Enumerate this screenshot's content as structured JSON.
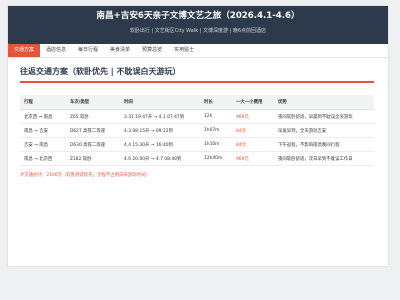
{
  "header": {
    "title": "南昌+吉安6天亲子文博文艺之旅（2026.4.1-4.6）",
    "subtitle": "软卧出行 | 文艺街区City Walk | 文博深度游 | 晚6点前回酒店"
  },
  "tabs": [
    {
      "label": "交通方案",
      "active": true
    },
    {
      "label": "酒店信息",
      "active": false
    },
    {
      "label": "每日行程",
      "active": false
    },
    {
      "label": "美食清单",
      "active": false
    },
    {
      "label": "预算总览",
      "active": false
    },
    {
      "label": "实用贴士",
      "active": false
    }
  ],
  "section": {
    "title": "往返交通方案（软卧优先 | 不耽误白天游玩）"
  },
  "table": {
    "headers": [
      "行程",
      "车次/类型",
      "时间",
      "时长",
      "一大一小费用",
      "优势"
    ],
    "rows": [
      [
        "北京西 → 南昌",
        "Z65 软卧",
        "3.31 19:47开 → 4.1 07:47到",
        "12h",
        "969元",
        "夜间软卧舒适，早晨到不耽误全天游玩"
      ],
      [
        "南昌 → 吉安",
        "D627 高铁二等座",
        "4.3 08:15开 → 09:22到",
        "1h07m",
        "84元",
        "早发早到，全天游玩吉安"
      ],
      [
        "吉安 → 南昌",
        "D630 高铁二等座",
        "4.4 15:30开 → 16:40到",
        "1h10m",
        "84元",
        "下午返程，不影响南昌晚间行程"
      ],
      [
        "南昌 → 北京西",
        "Z182 软卧",
        "4.6 20:00开 → 4.7 08:40到",
        "12h40m",
        "969元",
        "夜间软卧舒适，次日早到不耽误工作日"
      ]
    ]
  },
  "total_text": "大交通总计：2106元（软卧舒适优先，全程不占用白天游玩时间）"
}
